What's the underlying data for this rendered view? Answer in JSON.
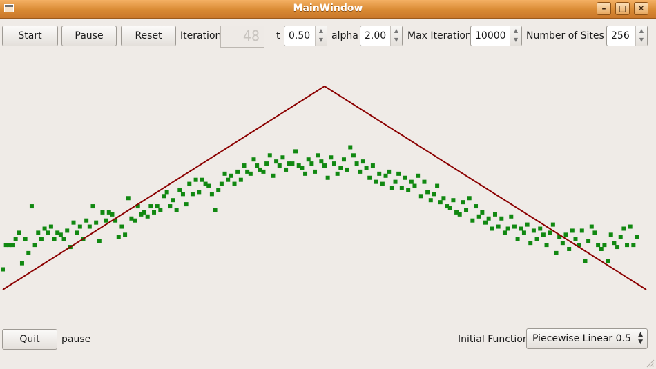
{
  "window": {
    "title": "MainWindow",
    "buttons": {
      "minimize": "–",
      "maximize": "□",
      "close": "✕"
    }
  },
  "toolbar": {
    "start_label": "Start",
    "pause_label": "Pause",
    "reset_label": "Reset",
    "iteration_label": "Iteration",
    "iteration_value": "48",
    "t_label": "t",
    "t_value": "0.50",
    "alpha_label": "alpha",
    "alpha_value": "2.00",
    "max_iteration_label": "Max Iteration",
    "max_iteration_value": "10000",
    "sites_label": "Number of  Sites",
    "sites_value": "256"
  },
  "footer": {
    "quit_label": "Quit",
    "status_text": "pause",
    "initial_function_label": "Initial Function",
    "initial_function_value": "Piecewise Linear 0.5"
  },
  "colors": {
    "line": "#8b0000",
    "points": "#118811"
  },
  "chart_data": {
    "type": "scatter",
    "title": "",
    "xlabel": "",
    "ylabel": "",
    "xlim": [
      0,
      1
    ],
    "ylim": [
      0,
      1
    ],
    "grid": false,
    "legend": "none",
    "line_series": {
      "x": [
        0.0,
        0.5,
        1.0
      ],
      "y": [
        0.0,
        1.0,
        0.0
      ]
    },
    "points": [
      [
        0.0,
        0.1
      ],
      [
        0.005,
        0.22
      ],
      [
        0.01,
        0.22
      ],
      [
        0.015,
        0.22
      ],
      [
        0.02,
        0.25
      ],
      [
        0.025,
        0.28
      ],
      [
        0.03,
        0.13
      ],
      [
        0.035,
        0.25
      ],
      [
        0.04,
        0.18
      ],
      [
        0.045,
        0.41
      ],
      [
        0.05,
        0.22
      ],
      [
        0.055,
        0.28
      ],
      [
        0.06,
        0.25
      ],
      [
        0.065,
        0.3
      ],
      [
        0.07,
        0.28
      ],
      [
        0.075,
        0.31
      ],
      [
        0.08,
        0.25
      ],
      [
        0.085,
        0.28
      ],
      [
        0.09,
        0.27
      ],
      [
        0.095,
        0.25
      ],
      [
        0.1,
        0.29
      ],
      [
        0.105,
        0.21
      ],
      [
        0.11,
        0.33
      ],
      [
        0.115,
        0.28
      ],
      [
        0.12,
        0.31
      ],
      [
        0.125,
        0.25
      ],
      [
        0.13,
        0.34
      ],
      [
        0.135,
        0.31
      ],
      [
        0.14,
        0.41
      ],
      [
        0.145,
        0.33
      ],
      [
        0.15,
        0.24
      ],
      [
        0.155,
        0.38
      ],
      [
        0.16,
        0.34
      ],
      [
        0.165,
        0.38
      ],
      [
        0.17,
        0.37
      ],
      [
        0.175,
        0.34
      ],
      [
        0.18,
        0.26
      ],
      [
        0.185,
        0.31
      ],
      [
        0.19,
        0.27
      ],
      [
        0.195,
        0.45
      ],
      [
        0.2,
        0.35
      ],
      [
        0.205,
        0.34
      ],
      [
        0.21,
        0.41
      ],
      [
        0.215,
        0.37
      ],
      [
        0.22,
        0.38
      ],
      [
        0.225,
        0.36
      ],
      [
        0.23,
        0.41
      ],
      [
        0.235,
        0.38
      ],
      [
        0.24,
        0.41
      ],
      [
        0.245,
        0.39
      ],
      [
        0.25,
        0.46
      ],
      [
        0.255,
        0.48
      ],
      [
        0.26,
        0.41
      ],
      [
        0.265,
        0.44
      ],
      [
        0.27,
        0.39
      ],
      [
        0.275,
        0.49
      ],
      [
        0.28,
        0.47
      ],
      [
        0.285,
        0.42
      ],
      [
        0.29,
        0.52
      ],
      [
        0.295,
        0.47
      ],
      [
        0.3,
        0.54
      ],
      [
        0.305,
        0.48
      ],
      [
        0.31,
        0.54
      ],
      [
        0.315,
        0.52
      ],
      [
        0.32,
        0.51
      ],
      [
        0.325,
        0.47
      ],
      [
        0.33,
        0.39
      ],
      [
        0.335,
        0.49
      ],
      [
        0.34,
        0.52
      ],
      [
        0.345,
        0.57
      ],
      [
        0.35,
        0.54
      ],
      [
        0.355,
        0.56
      ],
      [
        0.36,
        0.52
      ],
      [
        0.365,
        0.58
      ],
      [
        0.37,
        0.54
      ],
      [
        0.375,
        0.61
      ],
      [
        0.38,
        0.58
      ],
      [
        0.385,
        0.57
      ],
      [
        0.39,
        0.64
      ],
      [
        0.395,
        0.61
      ],
      [
        0.4,
        0.59
      ],
      [
        0.405,
        0.58
      ],
      [
        0.41,
        0.62
      ],
      [
        0.415,
        0.66
      ],
      [
        0.42,
        0.56
      ],
      [
        0.425,
        0.63
      ],
      [
        0.43,
        0.61
      ],
      [
        0.435,
        0.65
      ],
      [
        0.44,
        0.59
      ],
      [
        0.445,
        0.62
      ],
      [
        0.45,
        0.62
      ],
      [
        0.455,
        0.68
      ],
      [
        0.46,
        0.61
      ],
      [
        0.465,
        0.6
      ],
      [
        0.47,
        0.57
      ],
      [
        0.475,
        0.64
      ],
      [
        0.48,
        0.62
      ],
      [
        0.485,
        0.58
      ],
      [
        0.49,
        0.66
      ],
      [
        0.495,
        0.63
      ],
      [
        0.5,
        0.61
      ],
      [
        0.505,
        0.55
      ],
      [
        0.51,
        0.65
      ],
      [
        0.515,
        0.62
      ],
      [
        0.52,
        0.57
      ],
      [
        0.525,
        0.6
      ],
      [
        0.53,
        0.64
      ],
      [
        0.535,
        0.59
      ],
      [
        0.54,
        0.7
      ],
      [
        0.545,
        0.66
      ],
      [
        0.55,
        0.62
      ],
      [
        0.555,
        0.58
      ],
      [
        0.56,
        0.63
      ],
      [
        0.565,
        0.6
      ],
      [
        0.57,
        0.55
      ],
      [
        0.575,
        0.61
      ],
      [
        0.58,
        0.53
      ],
      [
        0.585,
        0.57
      ],
      [
        0.59,
        0.52
      ],
      [
        0.595,
        0.56
      ],
      [
        0.6,
        0.58
      ],
      [
        0.605,
        0.5
      ],
      [
        0.61,
        0.53
      ],
      [
        0.615,
        0.57
      ],
      [
        0.62,
        0.5
      ],
      [
        0.625,
        0.55
      ],
      [
        0.63,
        0.49
      ],
      [
        0.635,
        0.53
      ],
      [
        0.64,
        0.51
      ],
      [
        0.645,
        0.56
      ],
      [
        0.65,
        0.46
      ],
      [
        0.655,
        0.53
      ],
      [
        0.66,
        0.48
      ],
      [
        0.665,
        0.44
      ],
      [
        0.67,
        0.47
      ],
      [
        0.675,
        0.51
      ],
      [
        0.68,
        0.43
      ],
      [
        0.685,
        0.45
      ],
      [
        0.69,
        0.41
      ],
      [
        0.695,
        0.4
      ],
      [
        0.7,
        0.44
      ],
      [
        0.705,
        0.38
      ],
      [
        0.71,
        0.37
      ],
      [
        0.715,
        0.43
      ],
      [
        0.72,
        0.39
      ],
      [
        0.725,
        0.45
      ],
      [
        0.73,
        0.34
      ],
      [
        0.735,
        0.41
      ],
      [
        0.74,
        0.36
      ],
      [
        0.745,
        0.38
      ],
      [
        0.75,
        0.33
      ],
      [
        0.755,
        0.35
      ],
      [
        0.76,
        0.3
      ],
      [
        0.765,
        0.37
      ],
      [
        0.77,
        0.31
      ],
      [
        0.775,
        0.35
      ],
      [
        0.78,
        0.28
      ],
      [
        0.785,
        0.3
      ],
      [
        0.79,
        0.36
      ],
      [
        0.795,
        0.31
      ],
      [
        0.8,
        0.25
      ],
      [
        0.805,
        0.3
      ],
      [
        0.81,
        0.28
      ],
      [
        0.815,
        0.32
      ],
      [
        0.82,
        0.23
      ],
      [
        0.825,
        0.29
      ],
      [
        0.83,
        0.25
      ],
      [
        0.835,
        0.3
      ],
      [
        0.84,
        0.27
      ],
      [
        0.845,
        0.22
      ],
      [
        0.85,
        0.28
      ],
      [
        0.855,
        0.32
      ],
      [
        0.86,
        0.18
      ],
      [
        0.865,
        0.26
      ],
      [
        0.87,
        0.23
      ],
      [
        0.875,
        0.27
      ],
      [
        0.88,
        0.2
      ],
      [
        0.885,
        0.29
      ],
      [
        0.89,
        0.25
      ],
      [
        0.895,
        0.22
      ],
      [
        0.9,
        0.29
      ],
      [
        0.905,
        0.14
      ],
      [
        0.91,
        0.24
      ],
      [
        0.915,
        0.31
      ],
      [
        0.92,
        0.28
      ],
      [
        0.925,
        0.22
      ],
      [
        0.93,
        0.2
      ],
      [
        0.935,
        0.22
      ],
      [
        0.94,
        0.14
      ],
      [
        0.945,
        0.27
      ],
      [
        0.95,
        0.23
      ],
      [
        0.955,
        0.21
      ],
      [
        0.96,
        0.26
      ],
      [
        0.965,
        0.3
      ],
      [
        0.97,
        0.22
      ],
      [
        0.975,
        0.31
      ],
      [
        0.98,
        0.22
      ],
      [
        0.985,
        0.26
      ]
    ]
  }
}
